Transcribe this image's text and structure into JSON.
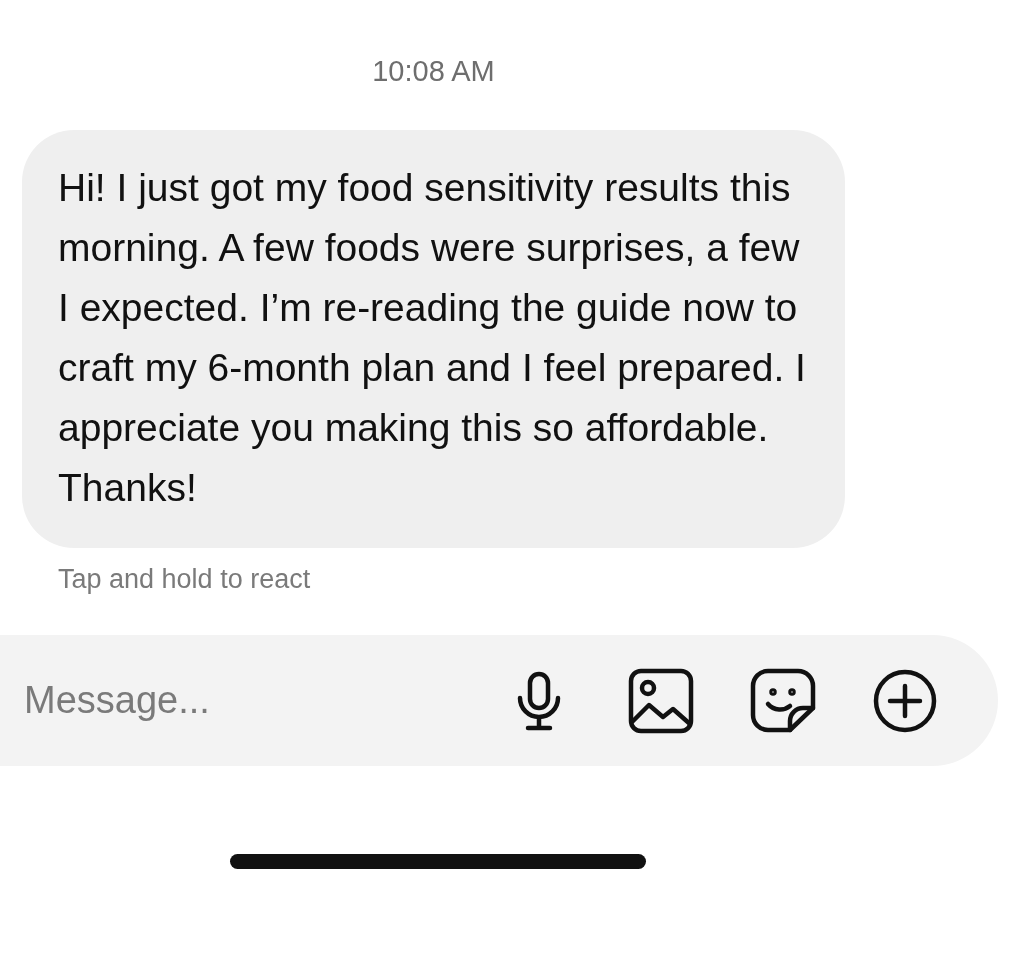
{
  "timestamp": "10:08 AM",
  "message": {
    "text": "Hi! I just got my food sensitivity results this morning. A few foods were surprises, a few I expected. I’m re-reading the guide now to craft my 6-month plan and I feel prepared. I appreciate you making this so affordable. Thanks!",
    "hint": "Tap and hold to react"
  },
  "composer": {
    "placeholder": "Message..."
  }
}
